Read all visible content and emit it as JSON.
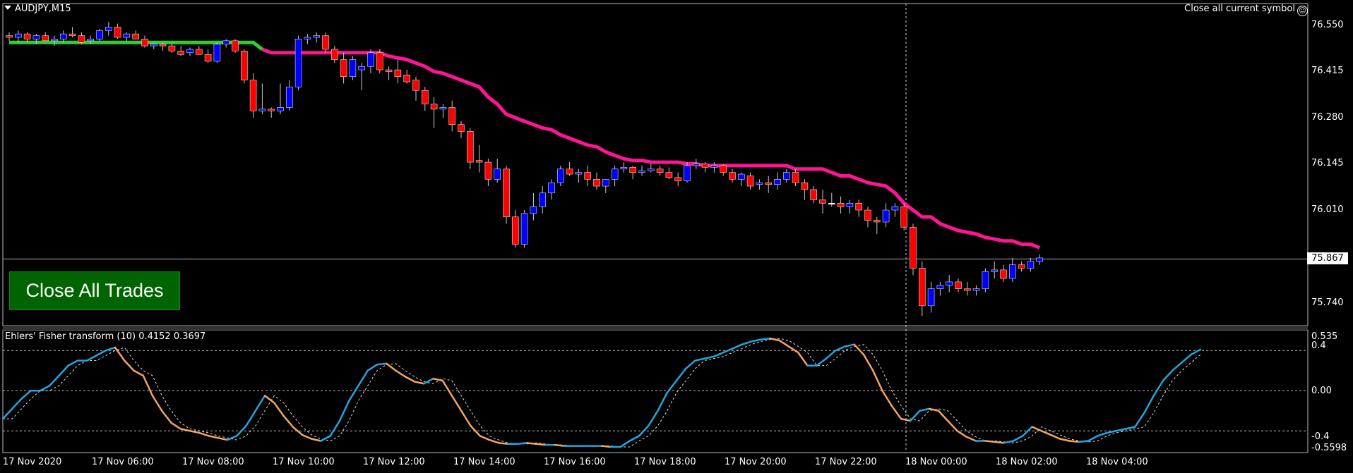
{
  "symbol_label": "AUDJPY,M15",
  "close_symbol_label": "Close all current symbol",
  "close_all_label": "Close All Trades",
  "indicator_label": "Ehlers' Fisher transform (10) 0.4152 0.3697",
  "current_price": "75.867",
  "price_axis": [
    "76.550",
    "76.415",
    "76.280",
    "76.145",
    "76.010",
    "75.740"
  ],
  "osc_axis": [
    "0.535",
    "0.4",
    "0.00",
    "-0.4",
    "-0.5598"
  ],
  "time_axis": [
    "17 Nov 2020",
    "17 Nov 06:00",
    "17 Nov 08:00",
    "17 Nov 10:00",
    "17 Nov 12:00",
    "17 Nov 14:00",
    "17 Nov 16:00",
    "17 Nov 18:00",
    "17 Nov 20:00",
    "17 Nov 22:00",
    "18 Nov 00:00",
    "18 Nov 02:00",
    "18 Nov 04:00"
  ],
  "colors": {
    "bull": "#0000ff",
    "bear": "#ff0000",
    "doji": "#ffffff",
    "trail_up": "#32cd32",
    "trail_down": "#ff1493",
    "fisher_up": "#1ea7e1",
    "fisher_down": "#f4a460",
    "button_bg": "#006400"
  },
  "chart_data": {
    "type": "candlestick",
    "symbol": "AUDJPY",
    "timeframe": "M15",
    "ylim": [
      75.7,
      76.6
    ],
    "candles": [
      [
        76.52,
        76.53,
        76.505,
        76.515
      ],
      [
        76.515,
        76.535,
        76.5,
        76.525
      ],
      [
        76.525,
        76.53,
        76.5,
        76.51
      ],
      [
        76.51,
        76.525,
        76.495,
        76.52
      ],
      [
        76.52,
        76.53,
        76.505,
        76.505
      ],
      [
        76.505,
        76.52,
        76.49,
        76.51
      ],
      [
        76.51,
        76.535,
        76.5,
        76.525
      ],
      [
        76.525,
        76.545,
        76.515,
        76.52
      ],
      [
        76.52,
        76.53,
        76.495,
        76.5
      ],
      [
        76.505,
        76.52,
        76.495,
        76.51
      ],
      [
        76.51,
        76.54,
        76.505,
        76.535
      ],
      [
        76.535,
        76.56,
        76.52,
        76.545
      ],
      [
        76.545,
        76.555,
        76.51,
        76.515
      ],
      [
        76.515,
        76.53,
        76.505,
        76.525
      ],
      [
        76.525,
        76.535,
        76.51,
        76.51
      ],
      [
        76.51,
        76.52,
        76.485,
        76.49
      ],
      [
        76.49,
        76.5,
        76.48,
        76.495
      ],
      [
        76.495,
        76.5,
        76.475,
        76.49
      ],
      [
        76.49,
        76.5,
        76.47,
        76.475
      ],
      [
        76.475,
        76.49,
        76.46,
        76.465
      ],
      [
        76.47,
        76.485,
        76.46,
        76.48
      ],
      [
        76.48,
        76.49,
        76.465,
        76.465
      ],
      [
        76.465,
        76.48,
        76.44,
        76.445
      ],
      [
        76.445,
        76.5,
        76.44,
        76.495
      ],
      [
        76.495,
        76.51,
        76.485,
        76.505
      ],
      [
        76.505,
        76.51,
        76.47,
        76.475
      ],
      [
        76.475,
        76.48,
        76.38,
        76.39
      ],
      [
        76.39,
        76.41,
        76.28,
        76.3
      ],
      [
        76.3,
        76.38,
        76.29,
        76.305
      ],
      [
        76.305,
        76.31,
        76.28,
        76.3
      ],
      [
        76.3,
        76.38,
        76.29,
        76.31
      ],
      [
        76.31,
        76.39,
        76.3,
        76.37
      ],
      [
        76.37,
        76.52,
        76.36,
        76.51
      ],
      [
        76.51,
        76.525,
        76.495,
        76.515
      ],
      [
        76.515,
        76.53,
        76.5,
        76.52
      ],
      [
        76.52,
        76.53,
        76.47,
        76.48
      ],
      [
        76.48,
        76.49,
        76.44,
        76.45
      ],
      [
        76.45,
        76.47,
        76.38,
        76.4
      ],
      [
        76.4,
        76.46,
        76.39,
        76.45
      ],
      [
        76.42,
        76.44,
        76.36,
        76.43
      ],
      [
        76.43,
        76.48,
        76.41,
        76.47
      ],
      [
        76.47,
        76.48,
        76.41,
        76.42
      ],
      [
        76.42,
        76.43,
        76.39,
        76.415
      ],
      [
        76.42,
        76.45,
        76.38,
        76.4
      ],
      [
        76.405,
        76.42,
        76.38,
        76.385
      ],
      [
        76.39,
        76.4,
        76.33,
        76.36
      ],
      [
        76.36,
        76.37,
        76.3,
        76.32
      ],
      [
        76.32,
        76.34,
        76.25,
        76.305
      ],
      [
        76.305,
        76.32,
        76.28,
        76.31
      ],
      [
        76.31,
        76.33,
        76.24,
        76.26
      ],
      [
        76.26,
        76.27,
        76.22,
        76.24
      ],
      [
        76.24,
        76.25,
        76.13,
        76.15
      ],
      [
        76.155,
        76.2,
        76.12,
        76.15
      ],
      [
        76.15,
        76.16,
        76.08,
        76.1
      ],
      [
        76.1,
        76.16,
        76.09,
        76.13
      ],
      [
        76.13,
        76.14,
        75.97,
        75.99
      ],
      [
        75.99,
        76.01,
        75.9,
        75.91
      ],
      [
        75.91,
        76.01,
        75.9,
        76.0
      ],
      [
        76.0,
        76.06,
        75.98,
        76.02
      ],
      [
        76.02,
        76.08,
        76.0,
        76.06
      ],
      [
        76.06,
        76.1,
        76.04,
        76.09
      ],
      [
        76.09,
        76.14,
        76.08,
        76.13
      ],
      [
        76.13,
        76.15,
        76.11,
        76.115
      ],
      [
        76.115,
        76.13,
        76.09,
        76.12
      ],
      [
        76.12,
        76.14,
        76.08,
        76.1
      ],
      [
        76.1,
        76.12,
        76.07,
        76.08
      ],
      [
        76.08,
        76.1,
        76.06,
        76.1
      ],
      [
        76.1,
        76.14,
        76.08,
        76.13
      ],
      [
        76.13,
        76.15,
        76.12,
        76.135
      ],
      [
        76.135,
        76.14,
        76.1,
        76.12
      ],
      [
        76.12,
        76.14,
        76.11,
        76.125
      ],
      [
        76.125,
        76.145,
        76.12,
        76.13
      ],
      [
        76.13,
        76.14,
        76.11,
        76.12
      ],
      [
        76.12,
        76.135,
        76.1,
        76.105
      ],
      [
        76.105,
        76.12,
        76.08,
        76.095
      ],
      [
        76.095,
        76.15,
        76.09,
        76.14
      ],
      [
        76.14,
        76.16,
        76.13,
        76.145
      ],
      [
        76.145,
        76.15,
        76.12,
        76.135
      ],
      [
        76.135,
        76.15,
        76.12,
        76.14
      ],
      [
        76.14,
        76.145,
        76.11,
        76.12
      ],
      [
        76.12,
        76.13,
        76.09,
        76.1
      ],
      [
        76.1,
        76.12,
        76.08,
        76.115
      ],
      [
        76.11,
        76.12,
        76.07,
        76.08
      ],
      [
        76.085,
        76.1,
        76.07,
        76.09
      ],
      [
        76.09,
        76.11,
        76.06,
        76.085
      ],
      [
        76.085,
        76.12,
        76.07,
        76.1
      ],
      [
        76.1,
        76.13,
        76.09,
        76.12
      ],
      [
        76.12,
        76.13,
        76.08,
        76.09
      ],
      [
        76.09,
        76.1,
        76.04,
        76.07
      ],
      [
        76.07,
        76.08,
        76.03,
        76.04
      ],
      [
        76.04,
        76.07,
        76.0,
        76.03
      ],
      [
        76.03,
        76.06,
        76.02,
        76.03
      ],
      [
        76.03,
        76.05,
        76.0,
        76.02
      ],
      [
        76.02,
        76.04,
        76.0,
        76.03
      ],
      [
        76.03,
        76.04,
        75.99,
        76.01
      ],
      [
        76.01,
        76.02,
        75.96,
        75.98
      ],
      [
        75.98,
        75.99,
        75.94,
        75.975
      ],
      [
        75.975,
        76.03,
        75.96,
        76.01
      ],
      [
        76.01,
        76.03,
        75.99,
        76.02
      ],
      [
        76.02,
        76.03,
        75.95,
        75.96
      ],
      [
        75.96,
        75.97,
        75.82,
        75.84
      ],
      [
        75.84,
        75.86,
        75.7,
        75.73
      ],
      [
        75.73,
        75.8,
        75.71,
        75.78
      ],
      [
        75.78,
        75.8,
        75.76,
        75.79
      ],
      [
        75.79,
        75.82,
        75.77,
        75.8
      ],
      [
        75.8,
        75.81,
        75.77,
        75.78
      ],
      [
        75.78,
        75.8,
        75.76,
        75.775
      ],
      [
        75.775,
        75.79,
        75.76,
        75.78
      ],
      [
        75.78,
        75.84,
        75.77,
        75.83
      ],
      [
        75.83,
        75.86,
        75.81,
        75.835
      ],
      [
        75.835,
        75.85,
        75.8,
        75.81
      ],
      [
        75.81,
        75.87,
        75.8,
        75.85
      ],
      [
        75.85,
        75.86,
        75.83,
        75.84
      ],
      [
        75.84,
        75.87,
        75.83,
        75.86
      ],
      [
        75.86,
        75.88,
        75.85,
        75.87
      ]
    ],
    "trail_stop": [
      76.5,
      76.5,
      76.5,
      76.5,
      76.5,
      76.5,
      76.5,
      76.5,
      76.5,
      76.5,
      76.5,
      76.5,
      76.5,
      76.5,
      76.5,
      76.5,
      76.5,
      76.5,
      76.5,
      76.5,
      76.5,
      76.5,
      76.5,
      76.5,
      76.5,
      76.5,
      76.5,
      76.5,
      76.48,
      76.47,
      76.47,
      76.47,
      76.47,
      76.47,
      76.47,
      76.47,
      76.47,
      76.47,
      76.47,
      76.47,
      76.47,
      76.47,
      76.46,
      76.455,
      76.45,
      76.44,
      76.43,
      76.415,
      76.41,
      76.4,
      76.39,
      76.38,
      76.37,
      76.34,
      76.32,
      76.29,
      76.28,
      76.27,
      76.26,
      76.25,
      76.245,
      76.23,
      76.22,
      76.21,
      76.2,
      76.195,
      76.18,
      76.17,
      76.16,
      76.155,
      76.155,
      76.15,
      76.15,
      76.15,
      76.15,
      76.145,
      76.145,
      76.14,
      76.14,
      76.14,
      76.14,
      76.14,
      76.14,
      76.14,
      76.14,
      76.14,
      76.14,
      76.13,
      76.13,
      76.13,
      76.13,
      76.12,
      76.11,
      76.11,
      76.1,
      76.09,
      76.085,
      76.08,
      76.06,
      76.03,
      76.01,
      75.99,
      75.99,
      75.97,
      75.96,
      75.95,
      75.945,
      75.94,
      75.93,
      75.925,
      75.92,
      75.92,
      75.91,
      75.91,
      75.9
    ],
    "trail_up_count": 29,
    "oscillator": {
      "name": "Ehlers' Fisher transform (10)",
      "ylim": [
        -0.5598,
        0.535
      ],
      "levels": [
        0.4,
        0.0,
        -0.4
      ],
      "fisher": [
        -0.28,
        -0.18,
        -0.08,
        0.0,
        0.0,
        0.05,
        0.15,
        0.25,
        0.3,
        0.3,
        0.35,
        0.4,
        0.43,
        0.3,
        0.2,
        0.15,
        -0.05,
        -0.2,
        -0.32,
        -0.38,
        -0.4,
        -0.42,
        -0.45,
        -0.47,
        -0.49,
        -0.45,
        -0.35,
        -0.2,
        -0.05,
        -0.12,
        -0.25,
        -0.36,
        -0.44,
        -0.48,
        -0.5,
        -0.45,
        -0.3,
        -0.1,
        0.05,
        0.2,
        0.26,
        0.27,
        0.2,
        0.14,
        0.09,
        0.07,
        0.12,
        0.1,
        -0.05,
        -0.2,
        -0.35,
        -0.45,
        -0.49,
        -0.52,
        -0.53,
        -0.53,
        -0.52,
        -0.53,
        -0.54,
        -0.54,
        -0.55,
        -0.55,
        -0.55,
        -0.55,
        -0.55,
        -0.56,
        -0.56,
        -0.5,
        -0.45,
        -0.35,
        -0.2,
        -0.02,
        0.1,
        0.22,
        0.3,
        0.32,
        0.34,
        0.38,
        0.42,
        0.46,
        0.49,
        0.51,
        0.52,
        0.5,
        0.44,
        0.38,
        0.25,
        0.25,
        0.32,
        0.4,
        0.44,
        0.46,
        0.36,
        0.2,
        0.0,
        -0.15,
        -0.28,
        -0.3,
        -0.2,
        -0.18,
        -0.2,
        -0.3,
        -0.4,
        -0.46,
        -0.5,
        -0.5,
        -0.51,
        -0.52,
        -0.5,
        -0.45,
        -0.36,
        -0.4,
        -0.44,
        -0.48,
        -0.5,
        -0.51,
        -0.5,
        -0.45,
        -0.42,
        -0.4,
        -0.38,
        -0.36,
        -0.22,
        -0.05,
        0.1,
        0.2,
        0.28,
        0.36,
        0.41
      ]
    }
  }
}
